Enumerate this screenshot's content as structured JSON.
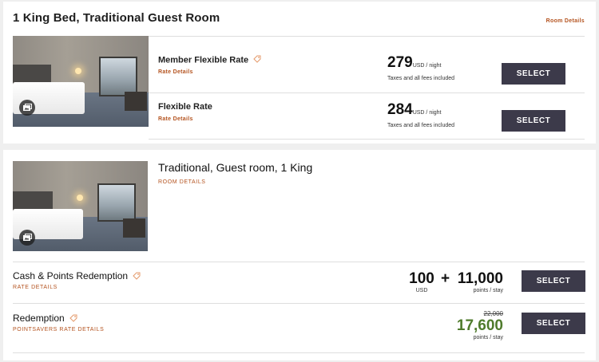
{
  "colors": {
    "accent_orange": "#b4531f",
    "button_bg": "#3c3a4a",
    "points_green": "#4f7b2c"
  },
  "room1": {
    "title": "1 King Bed, Traditional Guest Room",
    "details_link": "Room Details",
    "rates": [
      {
        "name": "Member Flexible Rate",
        "details_link": "Rate Details",
        "price": "279",
        "unit": "USD / night",
        "note": "Taxes and all fees included",
        "button": "SELECT",
        "icon": "tag-icon"
      },
      {
        "name": "Flexible Rate",
        "details_link": "Rate Details",
        "price": "284",
        "unit": "USD / night",
        "note": "Taxes and all fees included",
        "button": "SELECT"
      }
    ]
  },
  "room2": {
    "title": "Traditional, Guest room, 1 King",
    "details_link": "ROOM DETAILS",
    "rates": [
      {
        "name": "Cash & Points Redemption",
        "details_link": "RATE DETAILS",
        "cash": "100",
        "cash_unit": "USD",
        "plus": "+",
        "points": "11,000",
        "points_unit": "points / stay",
        "button": "SELECT",
        "icon": "tag-icon"
      },
      {
        "name": "Redemption",
        "details_link": "POINTSAVERS RATE DETAILS",
        "original_points": "22,000",
        "points": "17,600",
        "points_unit": "points / stay",
        "button": "SELECT",
        "icon": "tag-icon"
      }
    ]
  },
  "icons": {
    "gallery": "photo-gallery-icon"
  }
}
